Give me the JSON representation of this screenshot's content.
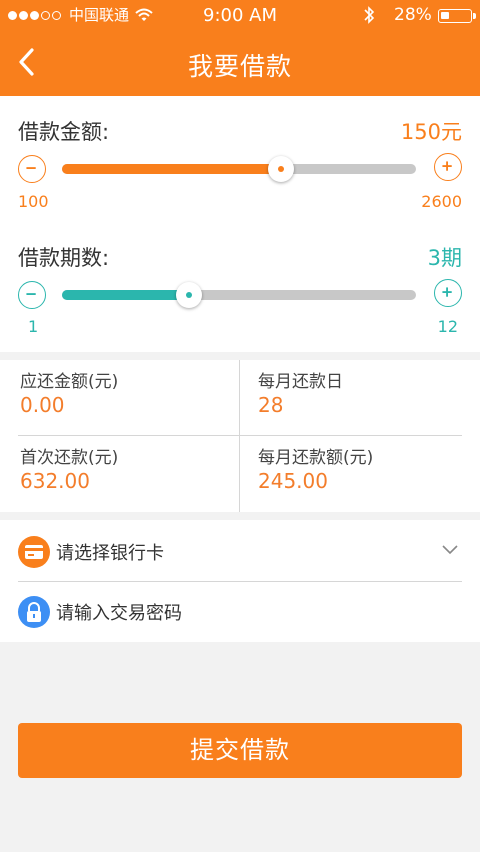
{
  "status_bar": {
    "carrier": "中国联通",
    "time": "9:00 AM",
    "battery_text": "28%",
    "battery_level": 0.28
  },
  "header": {
    "title": "我要借款",
    "back_icon": "chevron-left-icon"
  },
  "amount": {
    "label": "借款金额:",
    "value": "150元",
    "min": "100",
    "max": "2600",
    "slider_fraction": 0.62,
    "accent": "#f97f1c"
  },
  "term": {
    "label": "借款期数:",
    "value": "3期",
    "min": "1",
    "max": "12",
    "slider_fraction": 0.36,
    "accent": "#2bb6ad"
  },
  "summary": {
    "total_due_label": "应还金额(元)",
    "total_due_value": "0.00",
    "monthly_day_label": "每月还款日",
    "monthly_day_value": "28",
    "first_payment_label": "首次还款(元)",
    "first_payment_value": "632.00",
    "monthly_amount_label": "每月还款额(元)",
    "monthly_amount_value": "245.00"
  },
  "payment": {
    "bank_card_text": "请选择银行卡",
    "bank_card_icon": "credit-card-icon",
    "password_text": "请输入交易密码",
    "password_icon": "lock-icon"
  },
  "submit_label": "提交借款",
  "colors": {
    "brand_orange": "#f97f1c",
    "teal": "#2bb6ad",
    "lock_blue": "#3d8ff4",
    "track_gray": "#c8c8c8"
  }
}
